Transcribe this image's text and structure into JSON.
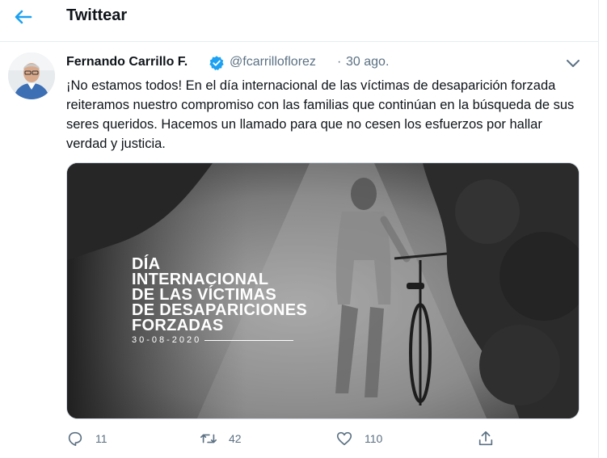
{
  "header": {
    "title": "Twittear"
  },
  "tweet": {
    "author_name": "Fernando Carrillo F.",
    "handle": "@fcarrilloflorez",
    "separator": "·",
    "time": "30 ago.",
    "text": "¡No estamos todos! En el día internacional de las víctimas de desaparición forzada reiteramos nuestro compromiso con las familias que continúan en la búsqueda de sus seres queridos. Hacemos un llamado para que no cesen los esfuerzos por hallar verdad y justicia.",
    "media": {
      "title_lines": [
        "DÍA",
        "INTERNACIONAL",
        "DE LAS VÍCTIMAS",
        "DE DESAPARICIONES",
        "FORZADAS"
      ],
      "date": "30-08-2020"
    },
    "actions": {
      "replies": "11",
      "retweets": "42",
      "likes": "110"
    }
  },
  "colors": {
    "accent": "#1da1f2",
    "muted_text": "#5b7083",
    "border": "#e6ecf0"
  },
  "icons": [
    "back-arrow-icon",
    "verified-badge-icon",
    "chevron-down-icon",
    "reply-icon",
    "retweet-icon",
    "like-icon",
    "share-icon"
  ]
}
